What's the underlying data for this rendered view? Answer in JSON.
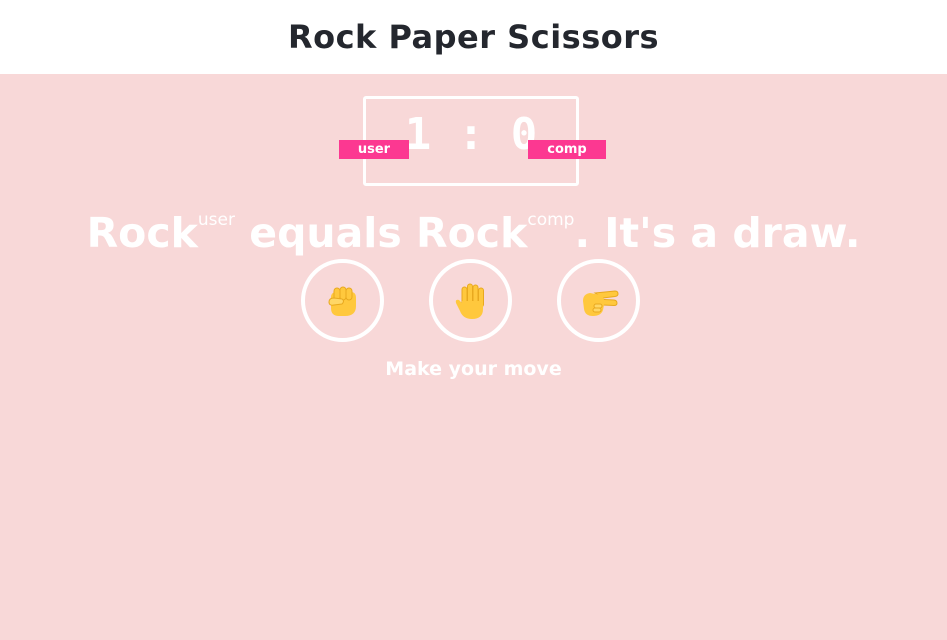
{
  "header": {
    "title": "Rock Paper Scissors"
  },
  "scoreboard": {
    "user_label": "user",
    "comp_label": "comp",
    "user_score": "1",
    "separator": ":",
    "comp_score": "0"
  },
  "result": {
    "user_choice": "Rock",
    "user_tag": "user",
    "verb": " equals ",
    "comp_choice": "Rock",
    "comp_tag": "comp",
    "outcome": ". It's a draw."
  },
  "choices": [
    {
      "name": "rock",
      "icon": "fist-icon"
    },
    {
      "name": "paper",
      "icon": "open-hand-icon"
    },
    {
      "name": "scissors",
      "icon": "victory-hand-icon"
    }
  ],
  "prompt": {
    "text": "Make your move"
  },
  "colors": {
    "background": "#f8d8d8",
    "header_bg": "#ffffff",
    "title_text": "#24272e",
    "badge": "#fc3891",
    "foreground": "#ffffff",
    "emoji_skin": "#ffc83d"
  }
}
